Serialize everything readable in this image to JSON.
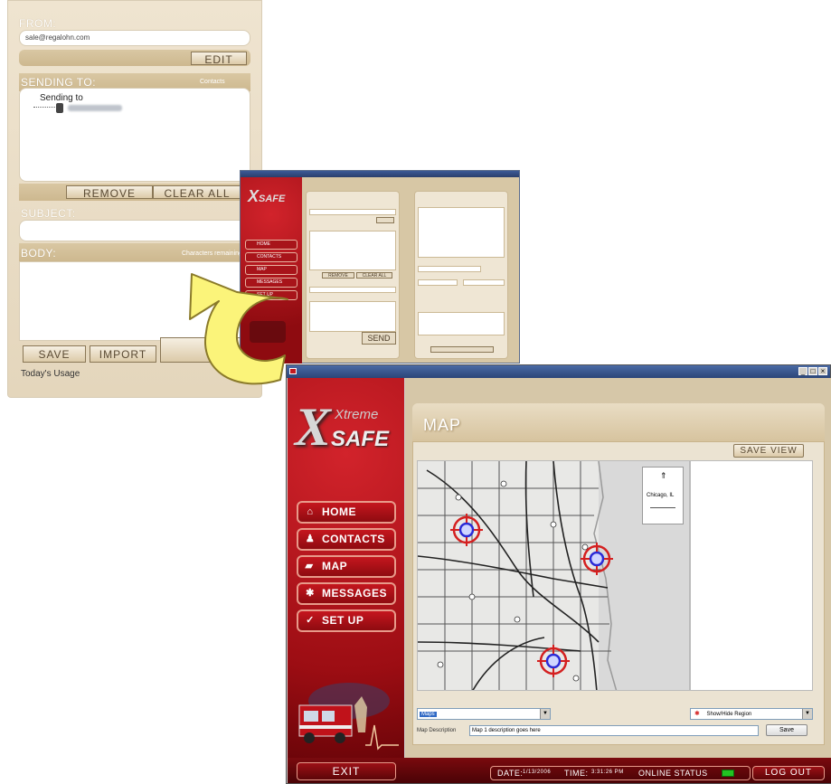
{
  "compose": {
    "from_label": "FROM:",
    "from_value": "sale@regalohn.com",
    "edit_label": "EDIT",
    "sending_to_label": "SENDING TO:",
    "contacts_link": "Contacts",
    "recipients_header": "Sending to",
    "remove_label": "REMOVE",
    "clear_all_label": "CLEAR ALL",
    "subject_label": "SUBJECT:",
    "body_label": "BODY:",
    "characters_label": "Characters remaining",
    "save_label": "SAVE",
    "import_label": "IMPORT",
    "todays_usage": "Today's Usage"
  },
  "small_window": {
    "send_label": "SEND",
    "nav": [
      "HOME",
      "CONTACTS",
      "MAP",
      "MESSAGES",
      "SET UP"
    ],
    "remove_label": "REMOVE",
    "clear_all_label": "CLEAR ALL"
  },
  "main_window": {
    "brand_top": "Xtreme",
    "brand_bottom": "SAFE",
    "nav": [
      {
        "label": "HOME",
        "icon": "home-icon"
      },
      {
        "label": "CONTACTS",
        "icon": "contacts-icon"
      },
      {
        "label": "MAP",
        "icon": "map-icon"
      },
      {
        "label": "MESSAGES",
        "icon": "messages-icon"
      },
      {
        "label": "SET UP",
        "icon": "setup-icon"
      }
    ],
    "page_title": "MAP",
    "save_view_label": "SAVE VIEW",
    "map_select_value": "Maps",
    "region_toggle_label": "Show/Hide Region",
    "map_description_label": "Map Description",
    "map_description_value": "Map 1 description goes here",
    "save_button_label": "Save",
    "exit_label": "EXIT",
    "date_label": "DATE:",
    "date_value": "1/13/2006",
    "time_label": "TIME:",
    "time_value": "3:31:26 PM",
    "online_status_label": "ONLINE STATUS",
    "logout_label": "LOG OUT",
    "legend_city": "Chicago, IL",
    "colors": {
      "accent_red": "#b5121b",
      "status_green": "#22c422",
      "panel_tan": "#d6c7a8"
    }
  }
}
